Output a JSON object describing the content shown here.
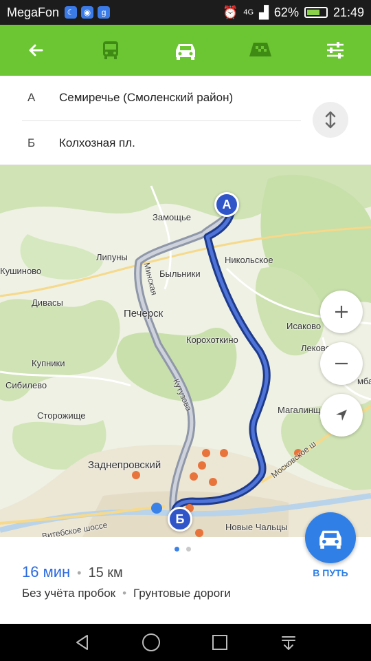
{
  "statusbar": {
    "carrier": "MegaFon",
    "network": "4G",
    "battery": "62%",
    "time": "21:49"
  },
  "toolbar": {
    "icons": [
      "back-arrow-icon",
      "bus-icon",
      "car-icon",
      "taxi-icon",
      "settings-sliders-icon"
    ],
    "active_color": "#ffffff",
    "inactive_color": "#3f8a15"
  },
  "route": {
    "from_marker": "А",
    "from_place": "Семиречье (Смоленский район)",
    "to_marker": "Б",
    "to_place": "Колхозная пл."
  },
  "map": {
    "labels": {
      "zamoshche": "Замощье",
      "lipuny": "Липуны",
      "nikolskoe": "Никольское",
      "kushinovo": "Кушиново",
      "bylniki": "Быльники",
      "divasy": "Дивасы",
      "pechersk": "Печерск",
      "isakovo": "Исаково",
      "lekovo": "Леково",
      "korokhotkino": "Корохоткино",
      "kupniki": "Купники",
      "sibilevo": "Сибилево",
      "magalinshchina": "Магалинщина",
      "storozhishche": "Сторожище",
      "zadneprovsky": "Заднепровский",
      "novoltsy": "Новые Чальцы",
      "mba": "мба"
    },
    "road_labels": {
      "minskaya": "Минская",
      "kutuzova": "Кутузова",
      "moskovskoe": "Московское ш",
      "vitebskoe": "Витебское шоссе"
    },
    "pin_a": "А",
    "pin_b": "Б",
    "route_color": "#3552b8"
  },
  "summary": {
    "time": "16 мин",
    "dot": "•",
    "distance": "15 км",
    "note1": "Без учёта пробок",
    "note2": "Грунтовые дороги",
    "go_label": "В ПУТЬ"
  },
  "carousel": {
    "pages": 2,
    "active": 1
  }
}
